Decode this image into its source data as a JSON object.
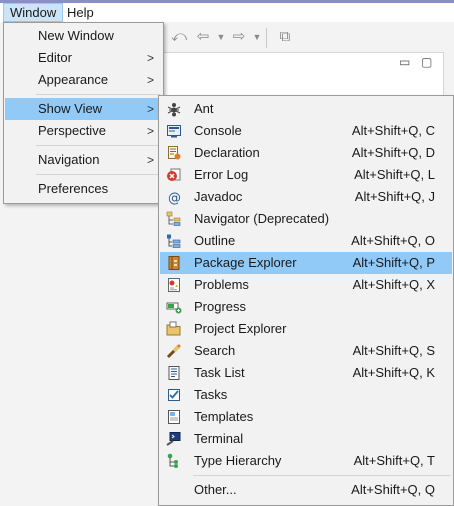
{
  "menubar": {
    "window": "Window",
    "help": "Help"
  },
  "window_menu": [
    {
      "label": "New Window",
      "arrow": ""
    },
    {
      "label": "Editor",
      "arrow": ">"
    },
    {
      "label": "Appearance",
      "arrow": ">"
    },
    {
      "label": "Show View",
      "arrow": ">"
    },
    {
      "label": "Perspective",
      "arrow": ">"
    },
    {
      "label": "Navigation",
      "arrow": ">"
    },
    {
      "label": "Preferences",
      "arrow": ""
    }
  ],
  "show_view_menu": [
    {
      "label": "Ant",
      "shortcut": "",
      "icon": "ant-icon"
    },
    {
      "label": "Console",
      "shortcut": "Alt+Shift+Q, C",
      "icon": "console-icon"
    },
    {
      "label": "Declaration",
      "shortcut": "Alt+Shift+Q, D",
      "icon": "declaration-icon"
    },
    {
      "label": "Error Log",
      "shortcut": "Alt+Shift+Q, L",
      "icon": "error-log-icon"
    },
    {
      "label": "Javadoc",
      "shortcut": "Alt+Shift+Q, J",
      "icon": "javadoc-icon"
    },
    {
      "label": "Navigator (Deprecated)",
      "shortcut": "",
      "icon": "navigator-icon"
    },
    {
      "label": "Outline",
      "shortcut": "Alt+Shift+Q, O",
      "icon": "outline-icon"
    },
    {
      "label": "Package Explorer",
      "shortcut": "Alt+Shift+Q, P",
      "icon": "package-explorer-icon"
    },
    {
      "label": "Problems",
      "shortcut": "Alt+Shift+Q, X",
      "icon": "problems-icon"
    },
    {
      "label": "Progress",
      "shortcut": "",
      "icon": "progress-icon"
    },
    {
      "label": "Project Explorer",
      "shortcut": "",
      "icon": "project-explorer-icon"
    },
    {
      "label": "Search",
      "shortcut": "Alt+Shift+Q, S",
      "icon": "search-icon"
    },
    {
      "label": "Task List",
      "shortcut": "Alt+Shift+Q, K",
      "icon": "task-list-icon"
    },
    {
      "label": "Tasks",
      "shortcut": "",
      "icon": "tasks-icon"
    },
    {
      "label": "Templates",
      "shortcut": "",
      "icon": "templates-icon"
    },
    {
      "label": "Terminal",
      "shortcut": "",
      "icon": "terminal-icon"
    },
    {
      "label": "Type Hierarchy",
      "shortcut": "Alt+Shift+Q, T",
      "icon": "type-hierarchy-icon"
    },
    {
      "label": "Other...",
      "shortcut": "Alt+Shift+Q, Q",
      "icon": ""
    }
  ],
  "highlight_color": "#91c9f7"
}
